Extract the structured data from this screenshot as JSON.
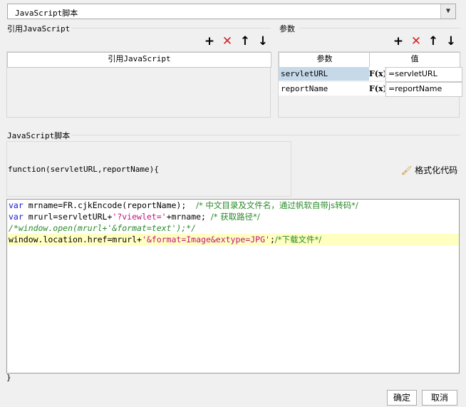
{
  "script_type": {
    "selected": "JavaScript脚本"
  },
  "ref_js": {
    "section_title": "引用JavaScript",
    "column_header": "引用JavaScript",
    "toolbar": [
      "add-icon",
      "delete-icon",
      "move-up-icon",
      "move-down-icon"
    ]
  },
  "params": {
    "section_title": "参数",
    "headers": {
      "param": "参数",
      "value": "值"
    },
    "rows": [
      {
        "name": "servletURL",
        "fx": "F(x)",
        "value": "=servletURL"
      },
      {
        "name": "reportName",
        "fx": "F(x)",
        "value": "=reportName"
      }
    ],
    "toolbar": [
      "add-icon",
      "delete-icon",
      "move-up-icon",
      "move-down-icon"
    ]
  },
  "script": {
    "section_title": "JavaScript脚本",
    "signature": "function(servletURL,reportName){",
    "format_label": "格式化代码",
    "closing": "}",
    "lines": [
      [
        "var",
        " mrname=FR.cjkEncode(reportName);  ",
        "/* 中文目录及文件名，通过帆软自带js转码*/"
      ],
      [
        "var",
        " mrurl=servletURL+",
        "'?viewlet='",
        "+mrname; ",
        "/* 获取路径*/"
      ],
      [
        "/*window.open(mrurl+'&format=text');*/"
      ],
      [
        "window.location.href=mrurl+",
        "'&format=Image&extype=JPG'",
        ";",
        "/*下载文件*/"
      ]
    ]
  },
  "buttons": {
    "ok": "确定",
    "cancel": "取消"
  },
  "colors": {
    "highlight_line": "#ffffc2",
    "selected_cell": "#c5d9e8",
    "delete": "#d32222"
  }
}
